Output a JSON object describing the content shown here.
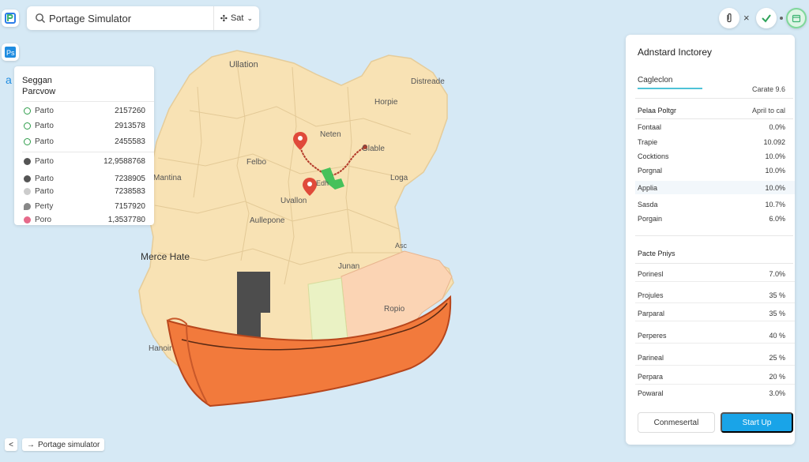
{
  "search": {
    "value": "Portage Simulator",
    "set_label": "Sat"
  },
  "top_controls": {
    "close_label": "×"
  },
  "legend": {
    "title": "Seggan",
    "subtitle": "Parcvow",
    "rows": [
      {
        "label": "Parto",
        "value": "2157260",
        "icon": "circle-outline-icon",
        "color": "#2e9d4a"
      },
      {
        "label": "Parto",
        "value": "2913578",
        "icon": "circle-outline-icon",
        "color": "#2e9d4a"
      },
      {
        "label": "Parto",
        "value": "2455583",
        "icon": "circle-outline-icon",
        "color": "#2e9d4a"
      },
      {
        "label": "Parto",
        "value": "12,9588768",
        "icon": "circle-filled-icon",
        "color": "#555555"
      },
      {
        "label": "Parto",
        "value": "7238905",
        "icon": "circle-filled-icon",
        "color": "#555555"
      },
      {
        "label": "Parto",
        "value": "7238583",
        "icon": "circle-filled-icon",
        "color": "#cccccc"
      },
      {
        "label": "Perty",
        "value": "7157920",
        "icon": "pin-icon",
        "color": "#888888"
      },
      {
        "label": "Poro",
        "value": "1,3537780",
        "icon": "circle-filled-icon",
        "color": "#e66a8a"
      }
    ]
  },
  "map": {
    "labels": [
      {
        "text": "Ullation"
      },
      {
        "text": "Distreade"
      },
      {
        "text": "Horpie"
      },
      {
        "text": "Neten"
      },
      {
        "text": "Glable"
      },
      {
        "text": "Felbo"
      },
      {
        "text": "Loga"
      },
      {
        "text": "Mantina"
      },
      {
        "text": "Edh"
      },
      {
        "text": "Uvallon"
      },
      {
        "text": "Aullepone"
      },
      {
        "text": "Merce Hate"
      },
      {
        "text": "Junan"
      },
      {
        "text": "Asc"
      },
      {
        "text": "Ropio"
      },
      {
        "text": "Hanoir"
      }
    ],
    "colors": {
      "land": "#f8e2b4",
      "district_green": "#eaf2c4",
      "district_orange": "#fbd4b4",
      "boat": "#f27a3c",
      "route": "#b43a2a"
    }
  },
  "panel": {
    "title": "Adnstard Inctorey",
    "tab_label": "Cagleclon",
    "tab_right": "Carate 9.6",
    "section1_head": "Pelaa Poltgr",
    "section1_head_right": "April to cal",
    "section1_rows": [
      {
        "label": "Fontaal",
        "value": "0.0%"
      },
      {
        "label": "Trapie",
        "value": "10.092"
      },
      {
        "label": "Cocktions",
        "value": "10.0%"
      },
      {
        "label": "Porgnal",
        "value": "10.0%"
      },
      {
        "label": "Applia",
        "value": "10.0%"
      },
      {
        "label": "Sasda",
        "value": "10.7%"
      },
      {
        "label": "Porgain",
        "value": "6.0%"
      }
    ],
    "section2_head": "Pacte Pniys",
    "section2_rows": [
      {
        "label": "Porinesl",
        "value": "7.0%"
      },
      {
        "label": "Projules",
        "value": "35 %"
      },
      {
        "label": "Parparal",
        "value": "35 %"
      },
      {
        "label": "Perperes",
        "value": "40 %"
      },
      {
        "label": "Parineal",
        "value": "25 %"
      },
      {
        "label": "Perpara",
        "value": "20 %"
      },
      {
        "label": "Powaral",
        "value": "3.0%"
      }
    ],
    "secondary_button": "Conmesertal",
    "primary_button": "Start Up"
  },
  "breadcrumb": {
    "back": "<",
    "crumb": "Portage simulator"
  }
}
